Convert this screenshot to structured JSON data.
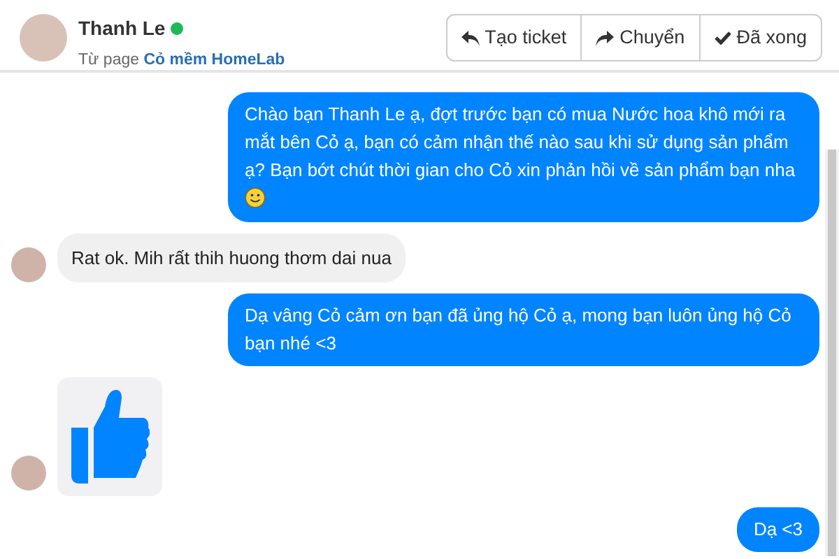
{
  "header": {
    "name": "Thanh Le",
    "online": true,
    "source_prefix": "Từ page",
    "source_page": "Cỏ mềm HomeLab",
    "buttons": [
      {
        "kind": "reply",
        "label": "Tạo ticket"
      },
      {
        "kind": "forward",
        "label": "Chuyển"
      },
      {
        "kind": "check",
        "label": "Đã xong"
      }
    ]
  },
  "messages": [
    {
      "kind": "outgoing",
      "text": "Chào bạn Thanh Le ạ, đợt trước bạn có mua Nước hoa khô mới ra mắt bên Cỏ ạ, bạn có cảm nhận thế nào sau khi sử dụng sản phẩm ạ? Bạn bớt chút thời gian cho Cỏ xin phản hồi về sản phẩm bạn nha",
      "emoji": true
    },
    {
      "kind": "incoming",
      "text": "Rat ok. Mih rất thih huong thơm dai nua"
    },
    {
      "kind": "outgoing",
      "text": "Dạ vâng Cỏ cảm ơn bạn đã ủng hộ Cỏ ạ, mong bạn luôn ủng hộ Cỏ bạn nhé <3"
    },
    {
      "kind": "like"
    },
    {
      "kind": "outgoing",
      "text": "Dạ <3"
    }
  ]
}
